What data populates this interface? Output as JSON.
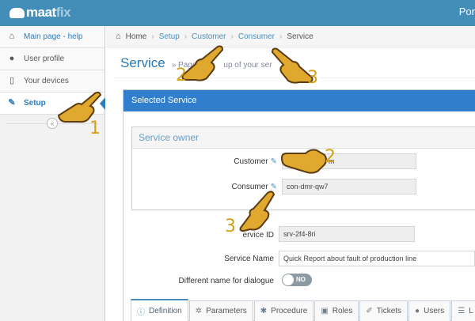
{
  "app": {
    "logo_name": "maat",
    "logo_suffix": "fix",
    "top_right": "Por"
  },
  "sidebar": {
    "items": [
      {
        "label": "Main page - help",
        "icon": "home-icon"
      },
      {
        "label": "User profile",
        "icon": "user-icon"
      },
      {
        "label": "Your devices",
        "icon": "mobile-icon"
      },
      {
        "label": "Setup",
        "icon": "wrench-icon"
      }
    ],
    "collapse_glyph": "«"
  },
  "breadcrumbs": [
    "Home",
    "Setup",
    "Customer",
    "Consumer",
    "Service"
  ],
  "page": {
    "title": "Service",
    "subtitle": "» Page",
    "subtitle_tail": "up of your ser"
  },
  "panel": {
    "title": "Selected Service"
  },
  "owner": {
    "heading": "Service owner",
    "customer_label": "Customer",
    "customer_value": "m",
    "consumer_label": "Consumer",
    "consumer_value": "con-dmr-qw7"
  },
  "fields": {
    "service_id_label": "ervice ID",
    "service_id_value": "srv-2f4-8ri",
    "service_name_label": "Service Name",
    "service_name_value": "Quick Report about fault of production line",
    "dialogue_label": "Different name for dialogue",
    "toggle_text": "NO"
  },
  "tabs": [
    {
      "label": "Definition",
      "icon": "info-icon",
      "active": true
    },
    {
      "label": "Parameters",
      "icon": "gear-icon",
      "active": false
    },
    {
      "label": "Procedure",
      "icon": "gears-icon",
      "active": false
    },
    {
      "label": "Roles",
      "icon": "briefcase-icon",
      "active": false
    },
    {
      "label": "Tickets",
      "icon": "tag-icon",
      "active": false
    },
    {
      "label": "Users",
      "icon": "users-icon",
      "active": false
    },
    {
      "label": "L",
      "icon": "list-icon",
      "active": false
    }
  ],
  "annotations": [
    "1",
    "2",
    "3",
    "2",
    "3"
  ],
  "colors": {
    "topbar": "#438eb9",
    "accent": "#2b7dbc",
    "panel_head": "#307ecc",
    "annotation": "#d4a017"
  }
}
